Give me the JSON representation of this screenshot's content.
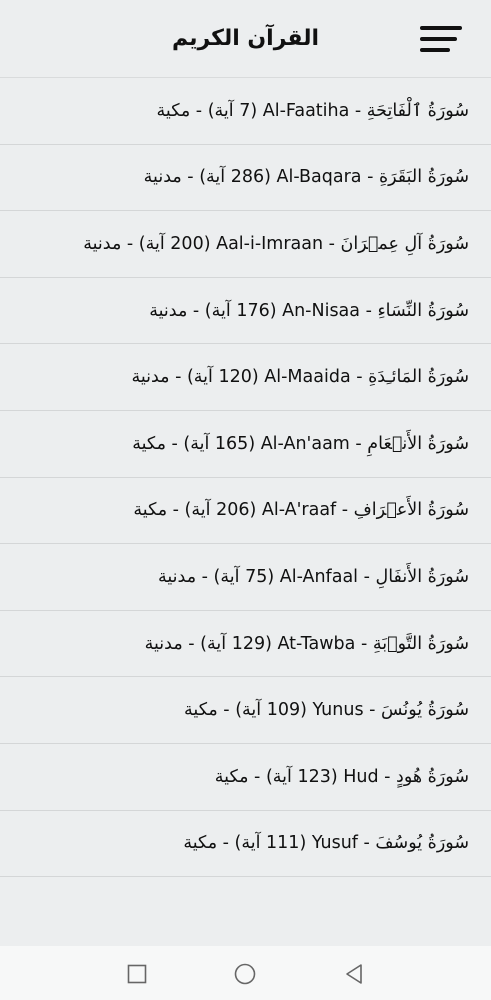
{
  "header": {
    "title": "القرآن الكريم",
    "menu_icon": "hamburger-menu-icon"
  },
  "surahs": [
    {
      "label": "سُورَةُ ٱلْفَاتِحَةِ - Al-Faatiha (7 آية) - مكية"
    },
    {
      "label": "سُورَةُ البَقَرَةِ - Al-Baqara (286 آية) - مدنية"
    },
    {
      "label": "سُورَةُ آلِ عِمۡرَانَ - Aal-i-Imraan (200 آية) - مدنية"
    },
    {
      "label": "سُورَةُ النِّسَاءِ - An-Nisaa (176 آية) - مدنية"
    },
    {
      "label": "سُورَةُ المَائـِدَةِ - Al-Maaida (120 آية) - مدنية"
    },
    {
      "label": "سُورَةُ الأَنۡعَامِ - Al-An'aam (165 آية) - مكية"
    },
    {
      "label": "سُورَةُ الأَعۡرَافِ - Al-A'raaf (206 آية) - مكية"
    },
    {
      "label": "سُورَةُ الأَنفَالِ - Al-Anfaal (75 آية) - مدنية"
    },
    {
      "label": "سُورَةُ التَّوۡبَةِ - At-Tawba (129 آية) - مدنية"
    },
    {
      "label": "سُورَةُ يُونُسَ - Yunus (109 آية) - مكية"
    },
    {
      "label": "سُورَةُ هُودٍ - Hud (123 آية) - مكية"
    },
    {
      "label": "سُورَةُ يُوسُفَ - Yusuf (111 آية) - مكية"
    }
  ],
  "nav": {
    "recents_icon": "square-icon",
    "home_icon": "circle-icon",
    "back_icon": "triangle-back-icon"
  }
}
